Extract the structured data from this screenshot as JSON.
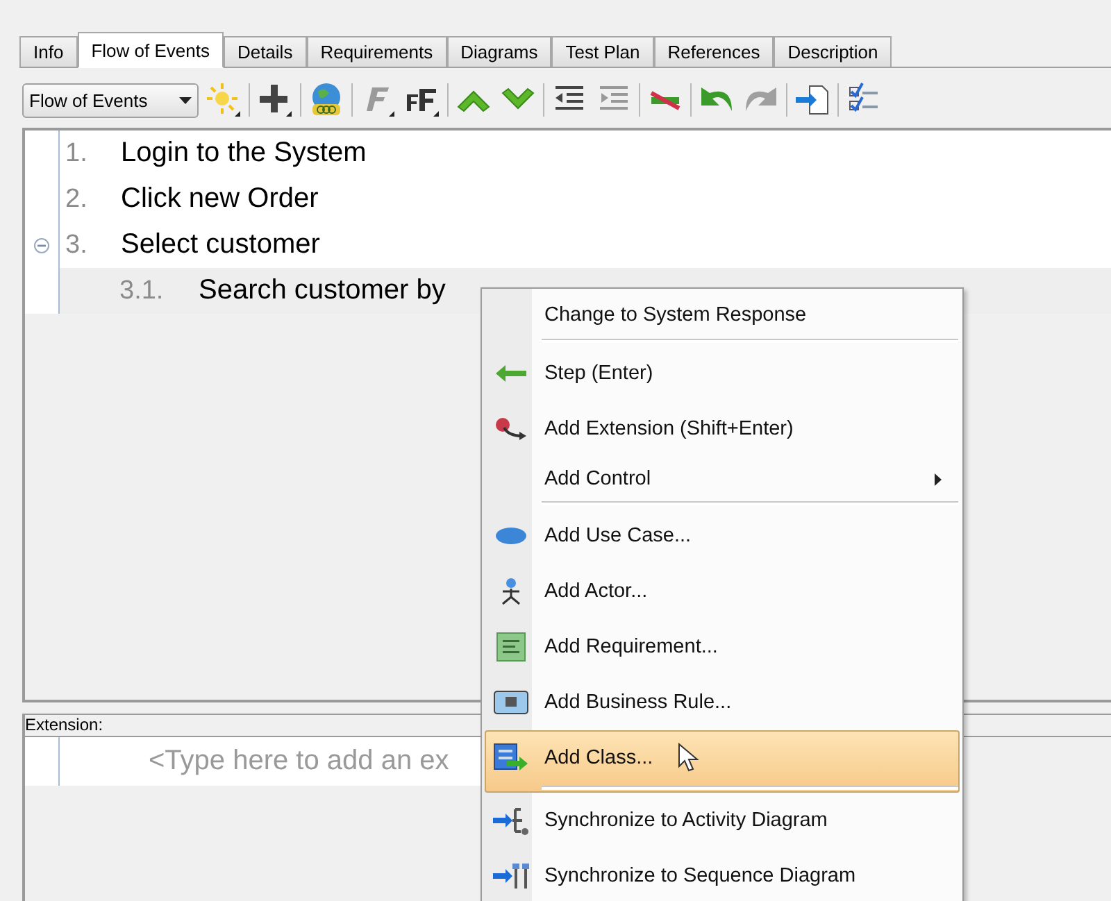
{
  "tabs": [
    {
      "label": "Info",
      "selected": false
    },
    {
      "label": "Flow of Events",
      "selected": true
    },
    {
      "label": "Details",
      "selected": false
    },
    {
      "label": "Requirements",
      "selected": false
    },
    {
      "label": "Diagrams",
      "selected": false
    },
    {
      "label": "Test Plan",
      "selected": false
    },
    {
      "label": "References",
      "selected": false
    },
    {
      "label": "Description",
      "selected": false
    }
  ],
  "toolbar": {
    "dropdown": "Flow of Events"
  },
  "steps": [
    {
      "number": "1.",
      "text": "Login to the System",
      "selected": false
    },
    {
      "number": "2.",
      "text": "Click new Order",
      "selected": false
    },
    {
      "number": "3.",
      "text": "Select customer",
      "selected": false,
      "expanded": true,
      "children": [
        {
          "number": "3.1.",
          "text": "Search customer by",
          "selected": true
        }
      ]
    }
  ],
  "extension": {
    "label": "Extension:",
    "placeholder": "<Type here to add an ex"
  },
  "context_menu": {
    "items": [
      {
        "label": "Change to System Response",
        "selected": false,
        "submenu": false,
        "separator_after": true
      },
      {
        "label": "Step (Enter)",
        "selected": false,
        "submenu": false,
        "separator_after": false
      },
      {
        "label": "Add Extension (Shift+Enter)",
        "selected": false,
        "submenu": false,
        "separator_after": false
      },
      {
        "label": "Add Control",
        "selected": false,
        "submenu": true,
        "separator_after": true
      },
      {
        "label": "Add Use Case...",
        "selected": false,
        "submenu": false,
        "separator_after": false
      },
      {
        "label": "Add Actor...",
        "selected": false,
        "submenu": false,
        "separator_after": false
      },
      {
        "label": "Add Requirement...",
        "selected": false,
        "submenu": false,
        "separator_after": false
      },
      {
        "label": "Add Business Rule...",
        "selected": false,
        "submenu": false,
        "separator_after": false
      },
      {
        "label": "Add Class...",
        "selected": true,
        "submenu": false,
        "separator_after": true
      },
      {
        "label": "Synchronize to Activity Diagram",
        "selected": false,
        "submenu": false,
        "separator_after": false
      },
      {
        "label": "Synchronize to Sequence Diagram",
        "selected": false,
        "submenu": false,
        "separator_after": false
      }
    ]
  }
}
